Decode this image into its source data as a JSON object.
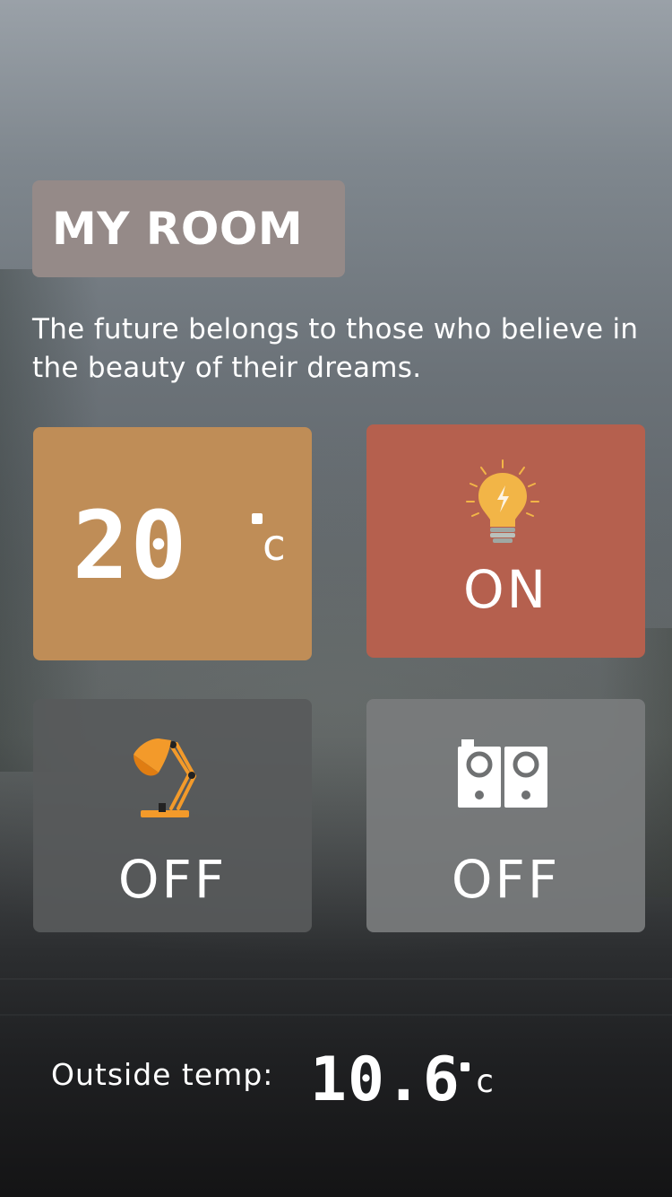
{
  "room": {
    "title": "MY ROOM",
    "quote": "The future belongs to those who believe in the beauty of their dreams."
  },
  "tiles": {
    "temperature": {
      "value": "20",
      "unit": "c",
      "icon": "thermometer-readout"
    },
    "light": {
      "state": "ON",
      "icon": "lightbulb-icon"
    },
    "lamp": {
      "state": "OFF",
      "icon": "desk-lamp-icon"
    },
    "speaker": {
      "state": "OFF",
      "icon": "speaker-icon"
    }
  },
  "outside": {
    "label": "Outside temp:",
    "value": "10.6",
    "unit": "c"
  },
  "colors": {
    "title_bg": "#958a88",
    "temperature_tile": "#bf8d57",
    "light_tile": "#b5604e",
    "lamp_tile": "#585a5b",
    "speaker_tile": "#7a7c7d",
    "bulb": "#f2b547",
    "lamp": "#f39a2a"
  }
}
